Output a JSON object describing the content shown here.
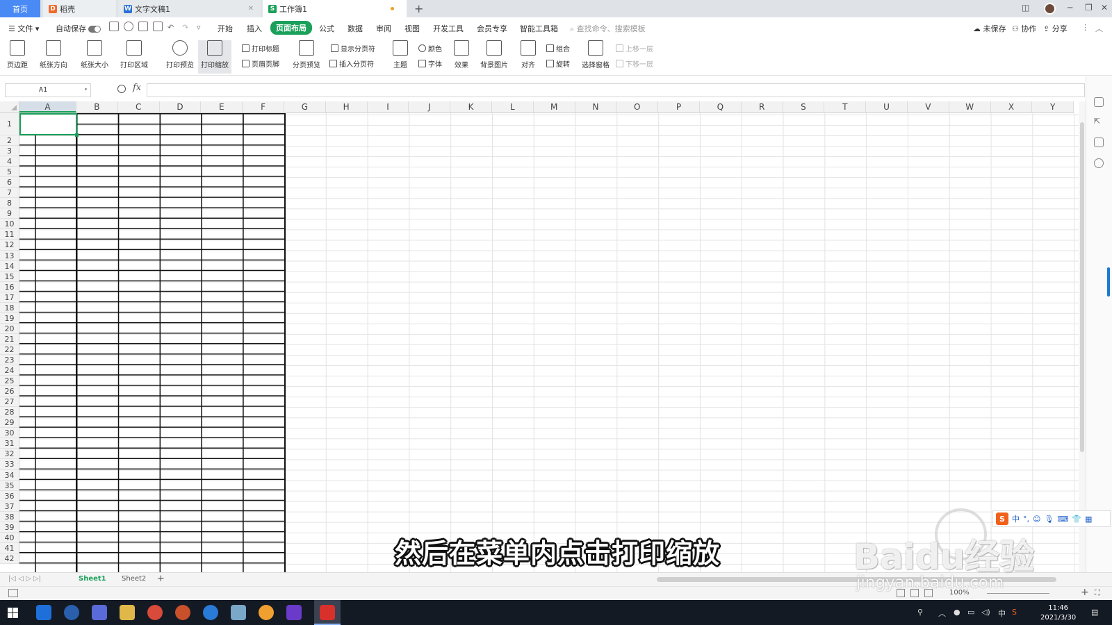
{
  "tabs": {
    "home": "首页",
    "tab2": "稻壳",
    "tab3": "文字文稿1",
    "tab4": "工作簿1"
  },
  "menu": {
    "file": "文件",
    "autosave": "自动保存",
    "items": [
      "开始",
      "插入",
      "页面布局",
      "公式",
      "数据",
      "审阅",
      "视图",
      "开发工具",
      "会员专享",
      "智能工具箱"
    ],
    "active": "页面布局",
    "search_placeholder": "查找命令、搜索模板",
    "unsaved": "未保存",
    "collab": "协作",
    "share": "分享"
  },
  "ribbon": {
    "margins": "页边距",
    "orientation": "纸张方向",
    "size": "纸张大小",
    "print_area": "打印区域",
    "print_preview": "打印预览",
    "print_scale": "打印缩放",
    "print_titles": "打印标题",
    "header_footer": "页眉页脚",
    "page_break_preview": "分页预览",
    "show_page_breaks": "显示分页符",
    "insert_page_break": "插入分页符",
    "theme": "主题",
    "colors": "颜色",
    "fonts": "字体",
    "effects": "效果",
    "background": "背景图片",
    "align": "对齐",
    "group": "组合",
    "rotate": "旋转",
    "selection_pane": "选择窗格",
    "bring_forward": "上移一层",
    "send_backward": "下移一层"
  },
  "formula": {
    "name_box": "A1",
    "fx": "fx"
  },
  "sheet": {
    "columns": [
      "A",
      "B",
      "C",
      "D",
      "E",
      "F",
      "G",
      "H",
      "I",
      "J",
      "K",
      "L",
      "M",
      "N",
      "O",
      "P",
      "Q",
      "R",
      "S",
      "T",
      "U",
      "V",
      "W",
      "X",
      "Y"
    ],
    "rows": [
      "1",
      "2",
      "3",
      "4",
      "5",
      "6",
      "7",
      "8",
      "9",
      "10",
      "11",
      "12",
      "13",
      "14",
      "15",
      "16",
      "17",
      "18",
      "19",
      "20",
      "21",
      "22",
      "23",
      "24",
      "25",
      "26",
      "27",
      "28",
      "29",
      "30",
      "31",
      "32",
      "33",
      "34",
      "35",
      "36",
      "37",
      "38",
      "39",
      "40",
      "41",
      "42"
    ]
  },
  "sheet_tabs": [
    "Sheet1",
    "Sheet2"
  ],
  "status": {
    "zoom": "100%"
  },
  "taskbar": {
    "time": "11:46",
    "date": "2021/3/30",
    "ime": "中"
  },
  "overlay": {
    "subtitle": "然后在菜单内点击打印缩放",
    "watermark": "Baidu经验",
    "watermark_url": "jingyan.baidu.com"
  }
}
